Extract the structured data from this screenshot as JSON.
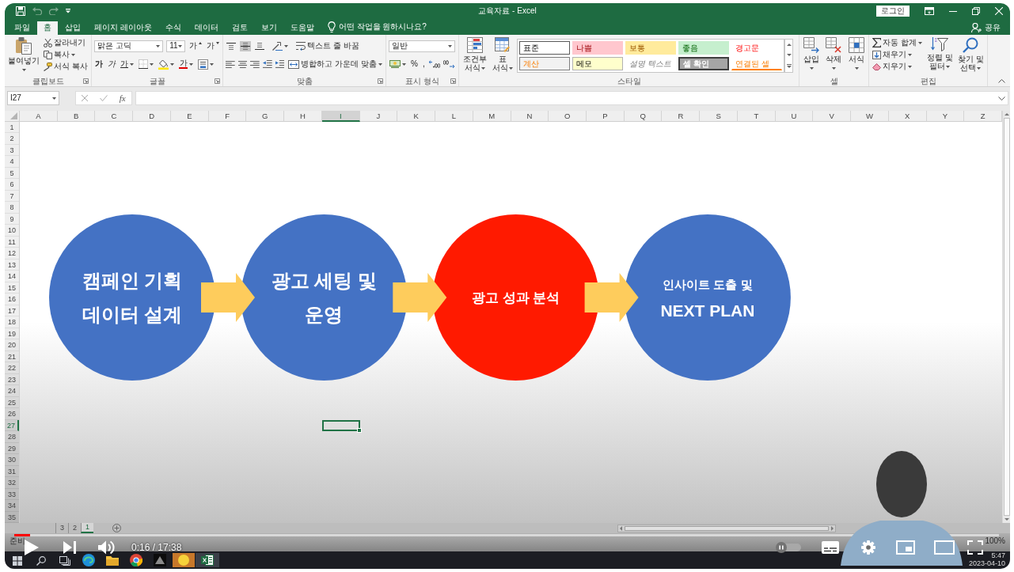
{
  "title_bar": {
    "quick_access": [
      {
        "kind": "save",
        "disabled": false
      },
      {
        "kind": "undo",
        "disabled": true
      },
      {
        "kind": "redo",
        "disabled": true
      },
      {
        "kind": "customize",
        "disabled": false
      }
    ],
    "title": "교육자료 - Excel",
    "login_button": "로그인"
  },
  "ribbon_tabs": [
    {
      "label": "파일",
      "selected": false
    },
    {
      "label": "홈",
      "selected": true
    },
    {
      "label": "삽입",
      "selected": false
    },
    {
      "label": "페이지 레이아웃",
      "selected": false
    },
    {
      "label": "수식",
      "selected": false
    },
    {
      "label": "데이터",
      "selected": false
    },
    {
      "label": "검토",
      "selected": false
    },
    {
      "label": "보기",
      "selected": false
    },
    {
      "label": "도움말",
      "selected": false
    }
  ],
  "tell_me": "어떤 작업을 원하시나요?",
  "share_button": "공유",
  "ribbon": {
    "clipboard": {
      "label": "클립보드",
      "paste": "붙여넣기",
      "cut": "잘라내기",
      "copy": "복사",
      "format_painter": "서식 복사"
    },
    "font": {
      "label": "글꼴",
      "font_name": "맑은 고딕",
      "font_size": "11",
      "grow_font": "가",
      "shrink_font": "가",
      "bold": "가",
      "italic": "가",
      "underline": "가",
      "font_color": "가"
    },
    "alignment": {
      "label": "맞춤",
      "vertical_align": [
        {
          "selected": false
        },
        {
          "selected": true
        },
        {
          "selected": false
        }
      ],
      "wrap_text": "텍스트 줄 바꿈",
      "merge_center": "병합하고 가운데 맞춤"
    },
    "number": {
      "label": "표시 형식",
      "format": "일반",
      "percent": "%",
      "comma": ","
    },
    "styles": {
      "label": "스타일",
      "conditional_formatting": "조건부 서식",
      "format_as_table": "표 서식",
      "cell_styles": [
        {
          "label": "표준",
          "kind": "normal",
          "selected": true
        },
        {
          "label": "나쁨",
          "kind": "bad",
          "selected": false
        },
        {
          "label": "보통",
          "kind": "neutral",
          "selected": false
        },
        {
          "label": "좋음",
          "kind": "good",
          "selected": false
        },
        {
          "label": "경고문",
          "kind": "warning",
          "selected": false
        },
        {
          "label": "계산",
          "kind": "calculation",
          "selected": false
        },
        {
          "label": "메모",
          "kind": "note",
          "selected": false
        },
        {
          "label": "설명 텍스트",
          "kind": "explanatory",
          "selected": false
        },
        {
          "label": "셀 확인",
          "kind": "check",
          "selected": false
        },
        {
          "label": "연결된 셀",
          "kind": "linked",
          "selected": false
        }
      ]
    },
    "cells": {
      "label": "셀",
      "insert": "삽입",
      "delete": "삭제",
      "format": "서식"
    },
    "editing": {
      "label": "편집",
      "autosum": "자동 합계",
      "fill": "채우기",
      "clear": "지우기",
      "sort_filter": "정렬 및 필터",
      "find_select": "찾기 및 선택"
    }
  },
  "formula_bar": {
    "name_box": "I27",
    "insert_function": "fx"
  },
  "columns": [
    {
      "label": "A",
      "selected": false
    },
    {
      "label": "B",
      "selected": false
    },
    {
      "label": "C",
      "selected": false
    },
    {
      "label": "D",
      "selected": false
    },
    {
      "label": "E",
      "selected": false
    },
    {
      "label": "F",
      "selected": false
    },
    {
      "label": "G",
      "selected": false
    },
    {
      "label": "H",
      "selected": false
    },
    {
      "label": "I",
      "selected": true
    },
    {
      "label": "J",
      "selected": false
    },
    {
      "label": "K",
      "selected": false
    },
    {
      "label": "L",
      "selected": false
    },
    {
      "label": "M",
      "selected": false
    },
    {
      "label": "N",
      "selected": false
    },
    {
      "label": "O",
      "selected": false
    },
    {
      "label": "P",
      "selected": false
    },
    {
      "label": "Q",
      "selected": false
    },
    {
      "label": "R",
      "selected": false
    },
    {
      "label": "S",
      "selected": false
    },
    {
      "label": "T",
      "selected": false
    },
    {
      "label": "U",
      "selected": false
    },
    {
      "label": "V",
      "selected": false
    },
    {
      "label": "W",
      "selected": false
    },
    {
      "label": "X",
      "selected": false
    },
    {
      "label": "Y",
      "selected": false
    },
    {
      "label": "Z",
      "selected": false
    }
  ],
  "rows": [
    {
      "label": "1",
      "selected": false
    },
    {
      "label": "2",
      "selected": false
    },
    {
      "label": "3",
      "selected": false
    },
    {
      "label": "4",
      "selected": false
    },
    {
      "label": "5",
      "selected": false
    },
    {
      "label": "6",
      "selected": false
    },
    {
      "label": "7",
      "selected": false
    },
    {
      "label": "8",
      "selected": false
    },
    {
      "label": "9",
      "selected": false
    },
    {
      "label": "10",
      "selected": false
    },
    {
      "label": "11",
      "selected": false
    },
    {
      "label": "12",
      "selected": false
    },
    {
      "label": "13",
      "selected": false
    },
    {
      "label": "14",
      "selected": false
    },
    {
      "label": "15",
      "selected": false
    },
    {
      "label": "16",
      "selected": false
    },
    {
      "label": "17",
      "selected": false
    },
    {
      "label": "18",
      "selected": false
    },
    {
      "label": "19",
      "selected": false
    },
    {
      "label": "20",
      "selected": false
    },
    {
      "label": "21",
      "selected": false
    },
    {
      "label": "22",
      "selected": false
    },
    {
      "label": "23",
      "selected": false
    },
    {
      "label": "24",
      "selected": false
    },
    {
      "label": "25",
      "selected": false
    },
    {
      "label": "26",
      "selected": false
    },
    {
      "label": "27",
      "selected": true
    },
    {
      "label": "28",
      "selected": false
    },
    {
      "label": "29",
      "selected": false
    },
    {
      "label": "30",
      "selected": false
    },
    {
      "label": "31",
      "selected": false
    },
    {
      "label": "32",
      "selected": false
    },
    {
      "label": "33",
      "selected": false
    },
    {
      "label": "34",
      "selected": false
    },
    {
      "label": "35",
      "selected": false
    }
  ],
  "diagram": {
    "steps": [
      {
        "lines": [
          "캠페인 기획",
          "데이터 설계"
        ],
        "color": "#4472c4"
      },
      {
        "lines": [
          "광고 세팅 및",
          "운영"
        ],
        "color": "#4472c4"
      },
      {
        "lines": [
          "광고 성과 분석"
        ],
        "color": "#ff1a00"
      },
      {
        "lines": [
          "인사이트 도출 및",
          "NEXT PLAN"
        ],
        "color": "#4472c4"
      }
    ]
  },
  "sheet_tabs": [
    {
      "label": "3",
      "selected": false
    },
    {
      "label": "2",
      "selected": false
    },
    {
      "label": "1",
      "selected": true
    }
  ],
  "status_bar": {
    "status": "준비",
    "zoom": "100%"
  },
  "player": {
    "playing": false,
    "progress": {
      "level": 0.016
    },
    "time": "0:16 / 17:38",
    "autoplay": false
  },
  "taskbar": {
    "apps": [
      {
        "kind": "swirl",
        "active": false
      },
      {
        "kind": "folder",
        "active": false
      },
      {
        "kind": "wheel",
        "active": false
      },
      {
        "kind": "triangle",
        "active": false
      },
      {
        "kind": "dot",
        "active": false
      },
      {
        "kind": "sheet",
        "active": true
      }
    ],
    "time": "5:47",
    "date": "2023-04-10"
  }
}
